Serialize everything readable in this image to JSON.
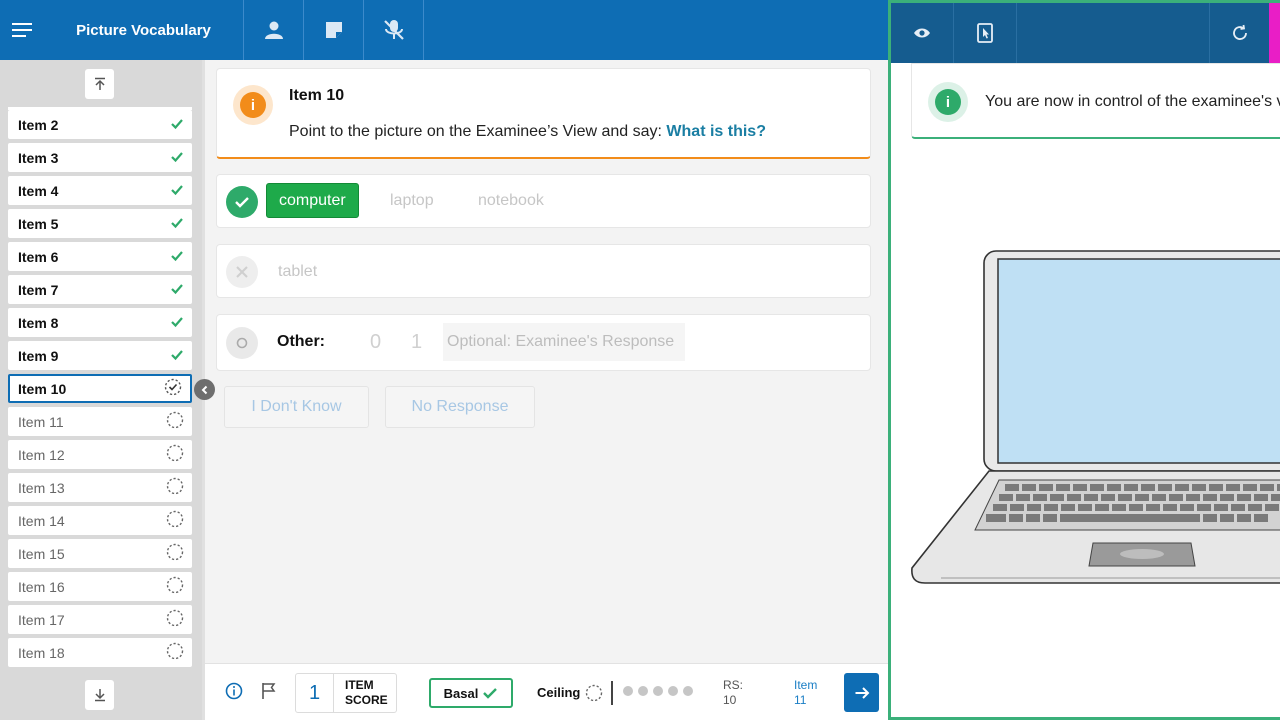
{
  "header": {
    "title": "Picture Vocabulary",
    "icons": [
      "menu-icon",
      "person-icon",
      "note-icon",
      "mic-off-icon"
    ]
  },
  "sidebar": {
    "items": [
      {
        "label": "Item 2",
        "status": "done"
      },
      {
        "label": "Item 3",
        "status": "done"
      },
      {
        "label": "Item 4",
        "status": "done"
      },
      {
        "label": "Item 5",
        "status": "done"
      },
      {
        "label": "Item 6",
        "status": "done"
      },
      {
        "label": "Item 7",
        "status": "done"
      },
      {
        "label": "Item 8",
        "status": "done"
      },
      {
        "label": "Item 9",
        "status": "done"
      },
      {
        "label": "Item 10",
        "status": "current"
      },
      {
        "label": "Item 11",
        "status": "pending"
      },
      {
        "label": "Item 12",
        "status": "pending"
      },
      {
        "label": "Item 13",
        "status": "pending"
      },
      {
        "label": "Item 14",
        "status": "pending"
      },
      {
        "label": "Item 15",
        "status": "pending"
      },
      {
        "label": "Item 16",
        "status": "pending"
      },
      {
        "label": "Item 17",
        "status": "pending"
      },
      {
        "label": "Item 18",
        "status": "pending"
      }
    ]
  },
  "instruction": {
    "title": "Item 10",
    "text": "Point to the picture on the Examinee’s View and say: ",
    "prompt": "What is this?"
  },
  "responses": {
    "correct": {
      "selected": "computer",
      "options": [
        "laptop",
        "notebook"
      ]
    },
    "incorrect": {
      "options": [
        "tablet"
      ]
    },
    "other": {
      "label": "Other:",
      "score0": "0",
      "score1": "1",
      "placeholder": "Optional: Examinee's Response",
      "value": ""
    },
    "buttons": {
      "dont_know": "I Don't Know",
      "no_response": "No Response"
    }
  },
  "footer": {
    "item_score_value": "1",
    "item_score_line1": "ITEM",
    "item_score_line2": "SCORE",
    "basal": "Basal",
    "ceiling": "Ceiling",
    "ceiling_dots": 5,
    "rs_label": "RS:",
    "rs_value": "10",
    "next_label": "Item",
    "next_value": "11"
  },
  "examinee_panel": {
    "notice": "You are now in control of the examinee's view",
    "icons": [
      "eye-icon",
      "tablet-pointer-icon",
      "refresh-icon"
    ],
    "image": "laptop-computer"
  },
  "colors": {
    "primary": "#0e6db4",
    "success": "#2eaa6a",
    "warning": "#f28c1a",
    "accent": "#e91ec6"
  }
}
